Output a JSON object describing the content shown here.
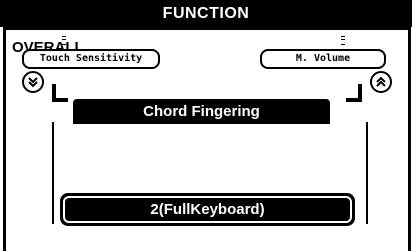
{
  "header": {
    "title": "FUNCTION"
  },
  "section": {
    "title": "OVERALL"
  },
  "params": {
    "left_label": "Touch Sensitivity",
    "right_label": "M. Volume"
  },
  "nav": {
    "prev_icon": "chevron-double-down-icon",
    "next_icon": "chevron-double-up-icon"
  },
  "current_function": {
    "label": "Chord Fingering"
  },
  "current_value": {
    "label": "2(FullKeyboard)"
  }
}
